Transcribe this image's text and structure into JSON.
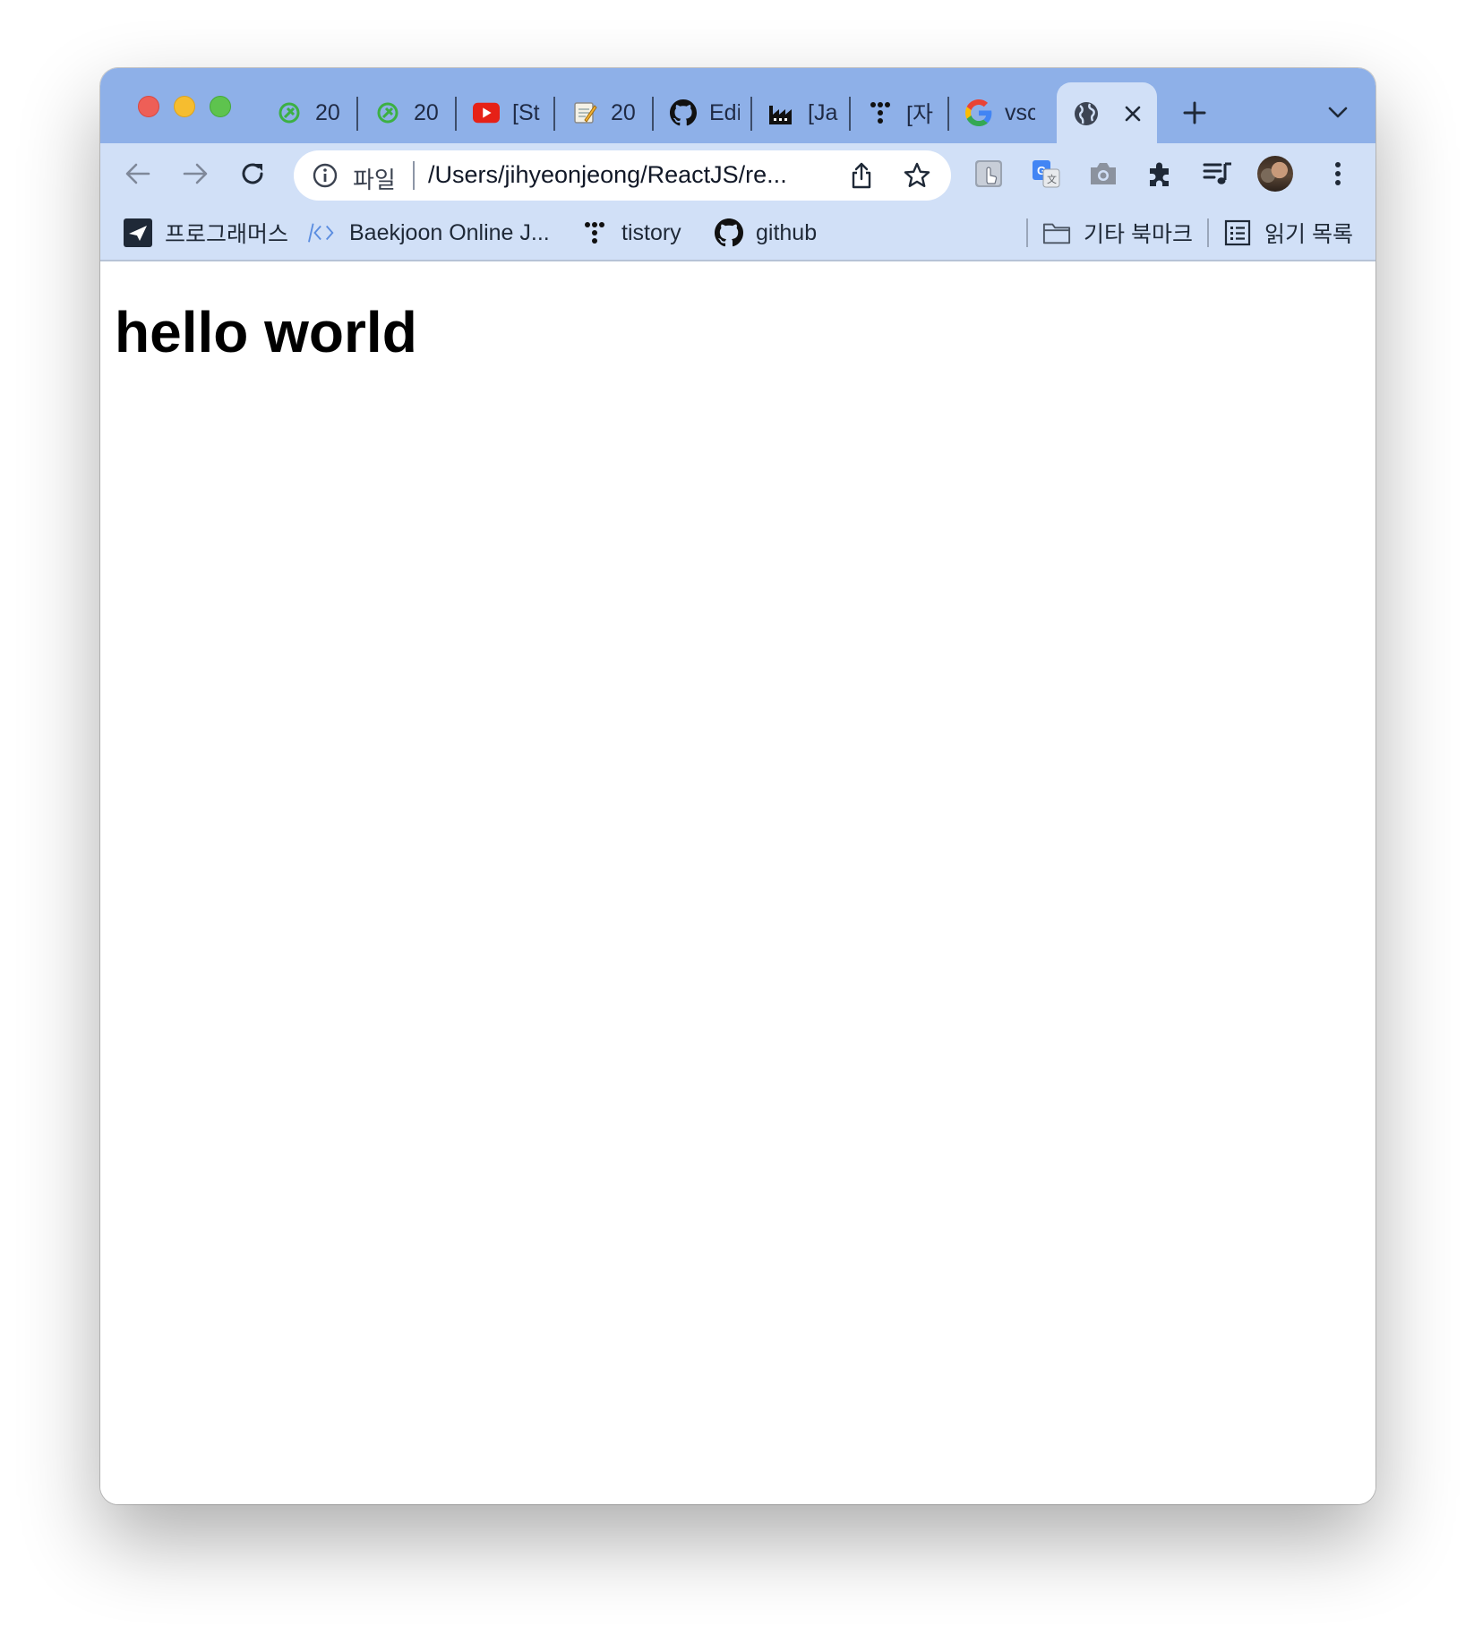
{
  "tabs": [
    {
      "icon": "leaf-icon",
      "title": "20"
    },
    {
      "icon": "leaf-icon",
      "title": "20"
    },
    {
      "icon": "youtube-icon",
      "title": "[St"
    },
    {
      "icon": "notepad-icon",
      "title": "20"
    },
    {
      "icon": "github-icon",
      "title": "Edi"
    },
    {
      "icon": "factory-icon",
      "title": "[Ja"
    },
    {
      "icon": "tistory-icon",
      "title": "[자"
    },
    {
      "icon": "google-icon",
      "title": "vsc"
    }
  ],
  "active_tab": {
    "icon": "globe-icon"
  },
  "omnibox": {
    "scheme_label": "파일",
    "url": "/Users/jihyeonjeong/ReactJS/re..."
  },
  "bookmarks": [
    {
      "icon": "programmers-icon",
      "label": "프로그래머스"
    },
    {
      "icon": "code-icon",
      "label": "Baekjoon Online J..."
    },
    {
      "icon": "tistory-icon",
      "label": "tistory"
    },
    {
      "icon": "github-icon",
      "label": "github"
    }
  ],
  "other_bookmarks": {
    "icon": "folder-icon",
    "label": "기타 북마크"
  },
  "reading_list": {
    "icon": "reading-list-icon",
    "label": "읽기 목록"
  },
  "page": {
    "heading": "hello world"
  },
  "colors": {
    "tabstrip": "#8eb0e8",
    "toolbar": "#d1e0f7",
    "leaf_green": "#3cb043",
    "youtube_red": "#e62117"
  }
}
